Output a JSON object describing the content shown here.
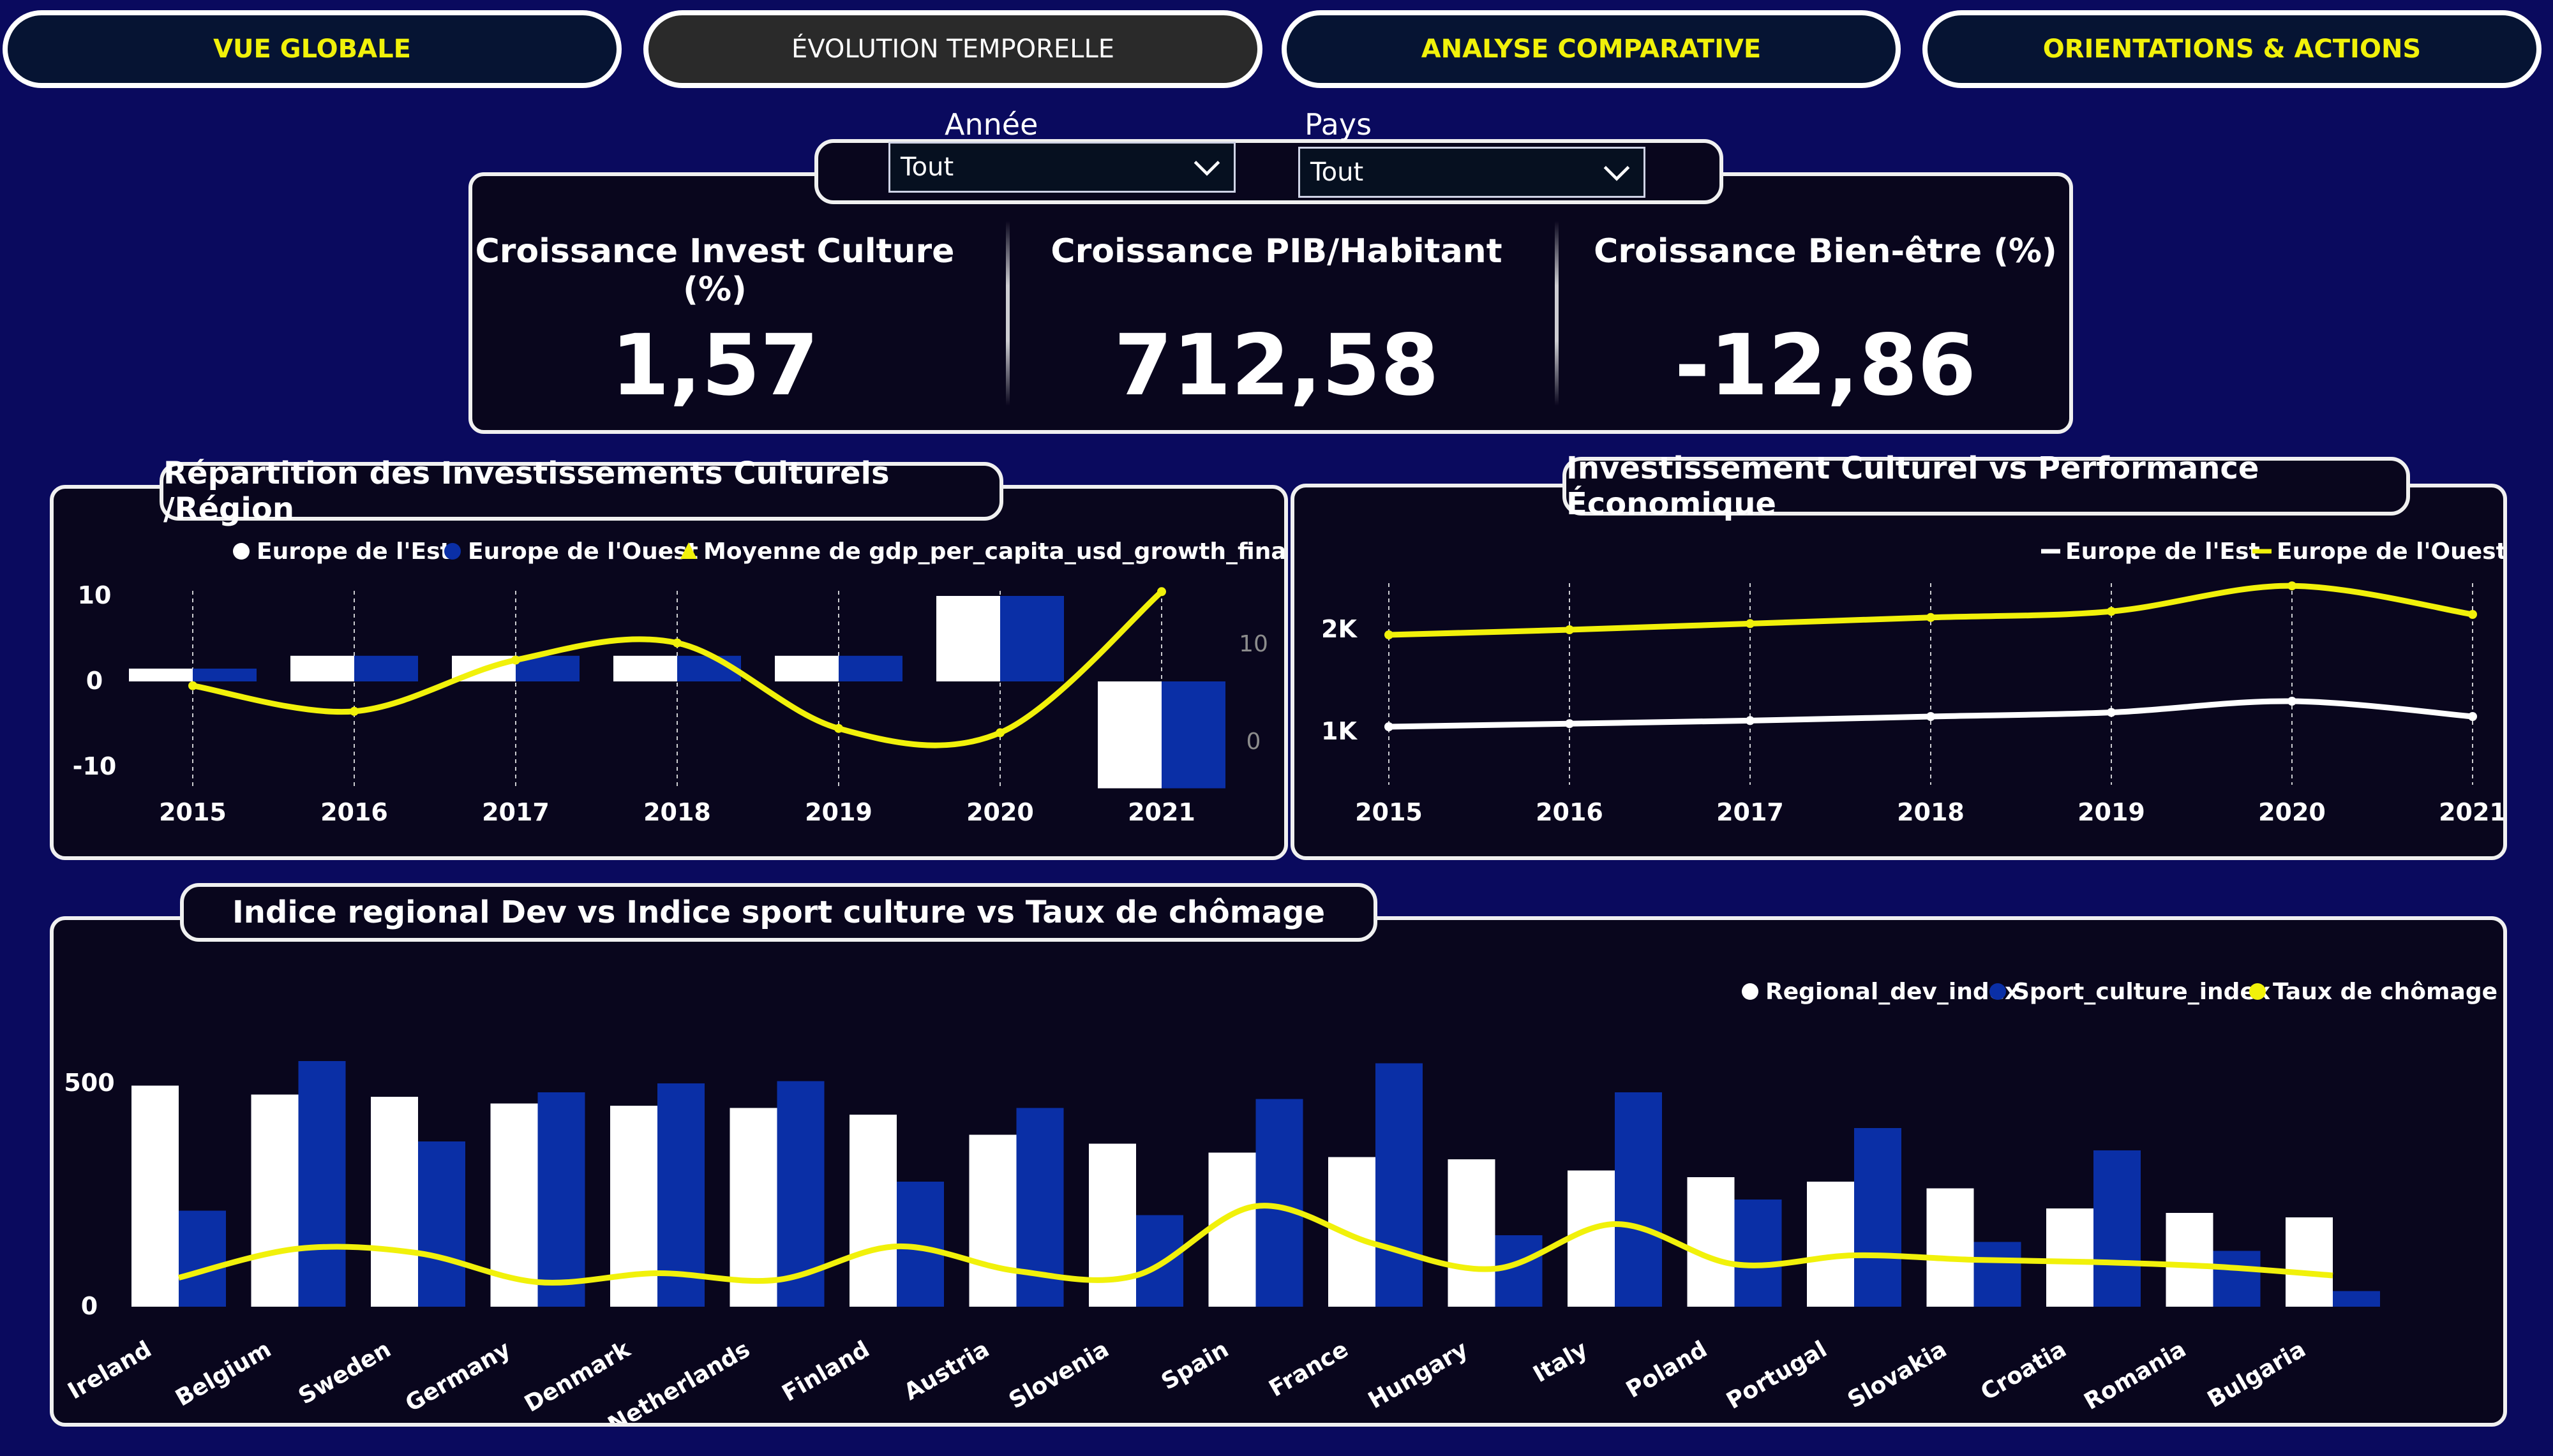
{
  "nav": {
    "tabs": [
      {
        "label": "VUE GLOBALE",
        "active": false
      },
      {
        "label": "ÉVOLUTION TEMPORELLE",
        "active": true
      },
      {
        "label": "ANALYSE COMPARATIVE",
        "active": false
      },
      {
        "label": "ORIENTATIONS & ACTIONS",
        "active": false
      }
    ]
  },
  "filters": {
    "year": {
      "label": "Année",
      "value": "Tout"
    },
    "country": {
      "label": "Pays",
      "value": "Tout"
    }
  },
  "kpis": [
    {
      "title": "Croissance Invest Culture (%)",
      "value": "1,57"
    },
    {
      "title": "Croissance PIB/Habitant",
      "value": "712,58"
    },
    {
      "title": "Croissance Bien-être (%)",
      "value": "-12,86"
    }
  ],
  "colors": {
    "background": "#0a0a5e",
    "panel": "#09061d",
    "accent_yellow": "#f1f10a",
    "series_white": "#ffffff",
    "series_blue": "#0a2fa6"
  },
  "chart_data": [
    {
      "type": "bar",
      "title": "Répartition des Investissements Culturels /Région",
      "categories": [
        "2015",
        "2016",
        "2017",
        "2018",
        "2019",
        "2020",
        "2021"
      ],
      "series": [
        {
          "name": "Europe de l'Est",
          "values": [
            1.5,
            3,
            3,
            3,
            3,
            10,
            -12.5
          ]
        },
        {
          "name": "Europe de l'Ouest",
          "values": [
            1.5,
            3,
            3,
            3,
            3,
            10,
            -12.5
          ]
        }
      ],
      "line_series": {
        "name": "Moyenne de gdp_per_capita_usd_growth_final_pct",
        "values": [
          -0.5,
          -3.5,
          2.5,
          4.5,
          -5.5,
          -6,
          10.5
        ]
      },
      "legend": [
        "Europe de l'Est",
        "Europe de l'Ouest",
        "Moyenne de gdp_per_capita_usd_growth_final_pct"
      ],
      "y_ticks": [
        "10",
        "0",
        "-10"
      ],
      "y2_ticks": [
        "10",
        "0"
      ],
      "ylim": [
        -12.5,
        10
      ],
      "legend_position": "top",
      "grid": "vertical dashed"
    },
    {
      "type": "line",
      "title": "Investissement Culturel vs Performance Économique",
      "x": [
        "2015",
        "2016",
        "2017",
        "2018",
        "2019",
        "2020",
        "2021"
      ],
      "series": [
        {
          "name": "Europe de l'Est",
          "values": [
            1050,
            1080,
            1110,
            1150,
            1190,
            1300,
            1150
          ]
        },
        {
          "name": "Europe de l'Ouest",
          "values": [
            1950,
            2000,
            2060,
            2120,
            2180,
            2430,
            2150
          ]
        }
      ],
      "y_ticks": [
        "2K",
        "1K"
      ],
      "legend_position": "top-right",
      "grid": "vertical dashed"
    },
    {
      "type": "bar",
      "title": "Indice regional Dev vs Indice sport culture vs Taux de chômage",
      "categories": [
        "Ireland",
        "Belgium",
        "Sweden",
        "Germany",
        "Denmark",
        "Netherlands",
        "Finland",
        "Austria",
        "Slovenia",
        "Spain",
        "France",
        "Hungary",
        "Italy",
        "Poland",
        "Portugal",
        "Slovakia",
        "Croatia",
        "Romania",
        "Bulgaria"
      ],
      "series": [
        {
          "name": "Regional_dev_index",
          "values": [
            495,
            475,
            470,
            455,
            450,
            445,
            430,
            385,
            365,
            345,
            335,
            330,
            305,
            290,
            280,
            265,
            220,
            210,
            200
          ]
        },
        {
          "name": "Sport_culture_index",
          "values": [
            215,
            550,
            370,
            480,
            500,
            505,
            280,
            445,
            205,
            465,
            545,
            160,
            480,
            240,
            400,
            145,
            350,
            125,
            35
          ]
        }
      ],
      "line_series": {
        "name": "Taux de chômage",
        "values": [
          65,
          130,
          120,
          55,
          75,
          60,
          135,
          80,
          70,
          225,
          140,
          85,
          185,
          95,
          115,
          105,
          100,
          90,
          70
        ]
      },
      "y_ticks": [
        "500",
        "0"
      ],
      "legend_position": "top-right"
    }
  ]
}
